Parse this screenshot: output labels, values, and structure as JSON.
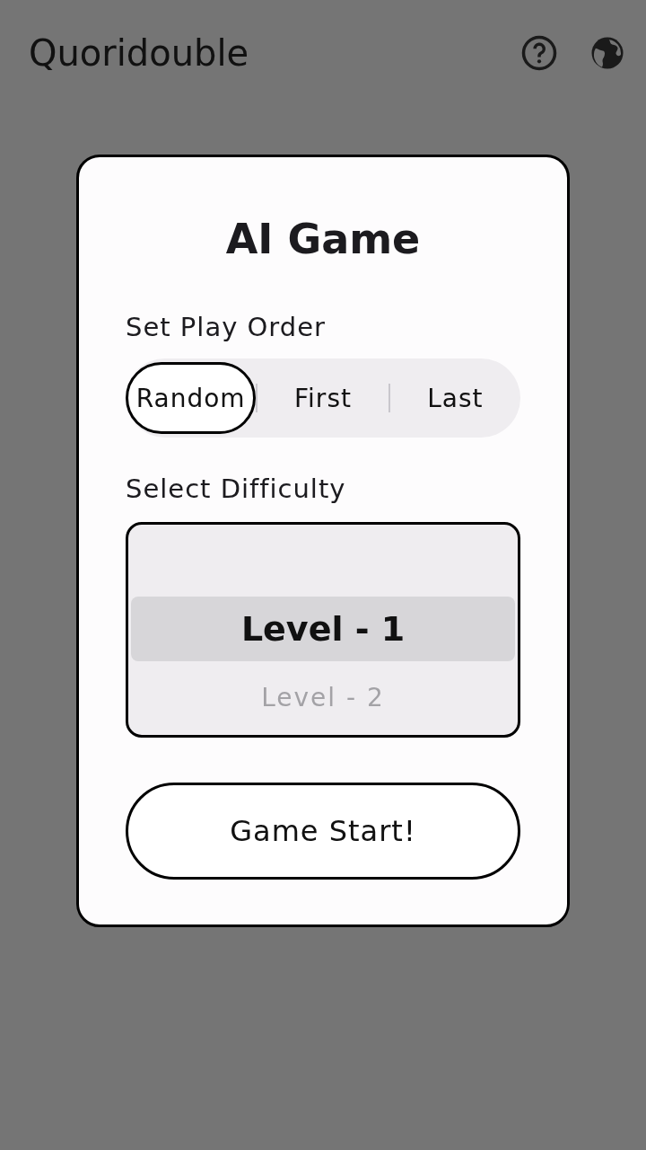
{
  "app_bar": {
    "title": "Quoridouble"
  },
  "dialog": {
    "title": "AI Game",
    "order_label": "Set Play Order",
    "order_options": [
      {
        "label": "Random",
        "selected": true
      },
      {
        "label": "First",
        "selected": false
      },
      {
        "label": "Last",
        "selected": false
      }
    ],
    "difficulty_label": "Select Difficulty",
    "levels": [
      {
        "label": "Level - 1",
        "selected": true
      },
      {
        "label": "Level - 2",
        "selected": false
      }
    ],
    "start_button": "Game Start!"
  }
}
